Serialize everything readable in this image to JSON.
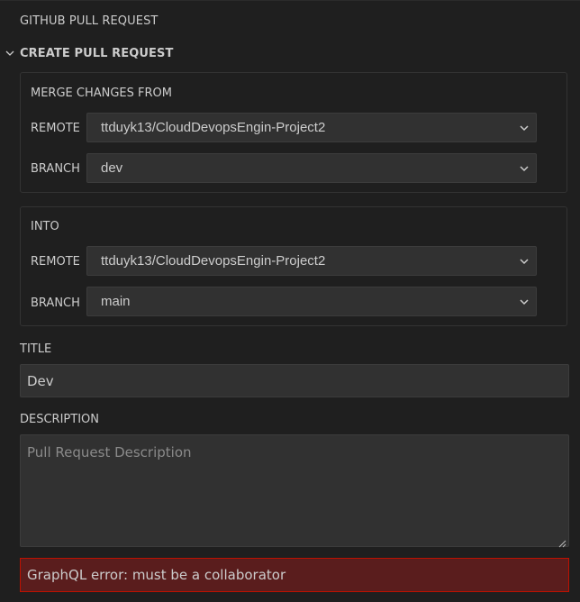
{
  "view": {
    "title": "GITHUB PULL REQUEST"
  },
  "section": {
    "title": "CREATE PULL REQUEST",
    "expanded_icon": "chevron-down-icon"
  },
  "merge_from": {
    "title": "MERGE CHANGES FROM",
    "remote_label": "REMOTE",
    "remote_value": "ttduyk13/CloudDevopsEngin-Project2",
    "branch_label": "BRANCH",
    "branch_value": "dev"
  },
  "into": {
    "title": "INTO",
    "remote_label": "REMOTE",
    "remote_value": "ttduyk13/CloudDevopsEngin-Project2",
    "branch_label": "BRANCH",
    "branch_value": "main"
  },
  "pr_title": {
    "label": "TITLE",
    "value": "Dev"
  },
  "pr_description": {
    "label": "DESCRIPTION",
    "placeholder": "Pull Request Description",
    "value": ""
  },
  "error": {
    "message": "GraphQL error: must be a collaborator"
  },
  "colors": {
    "background": "#1f1f1f",
    "input_background": "#313131",
    "error_background": "#5a1d1d",
    "error_border": "#be1100",
    "text": "#cccccc",
    "placeholder": "#8a8a8a"
  }
}
